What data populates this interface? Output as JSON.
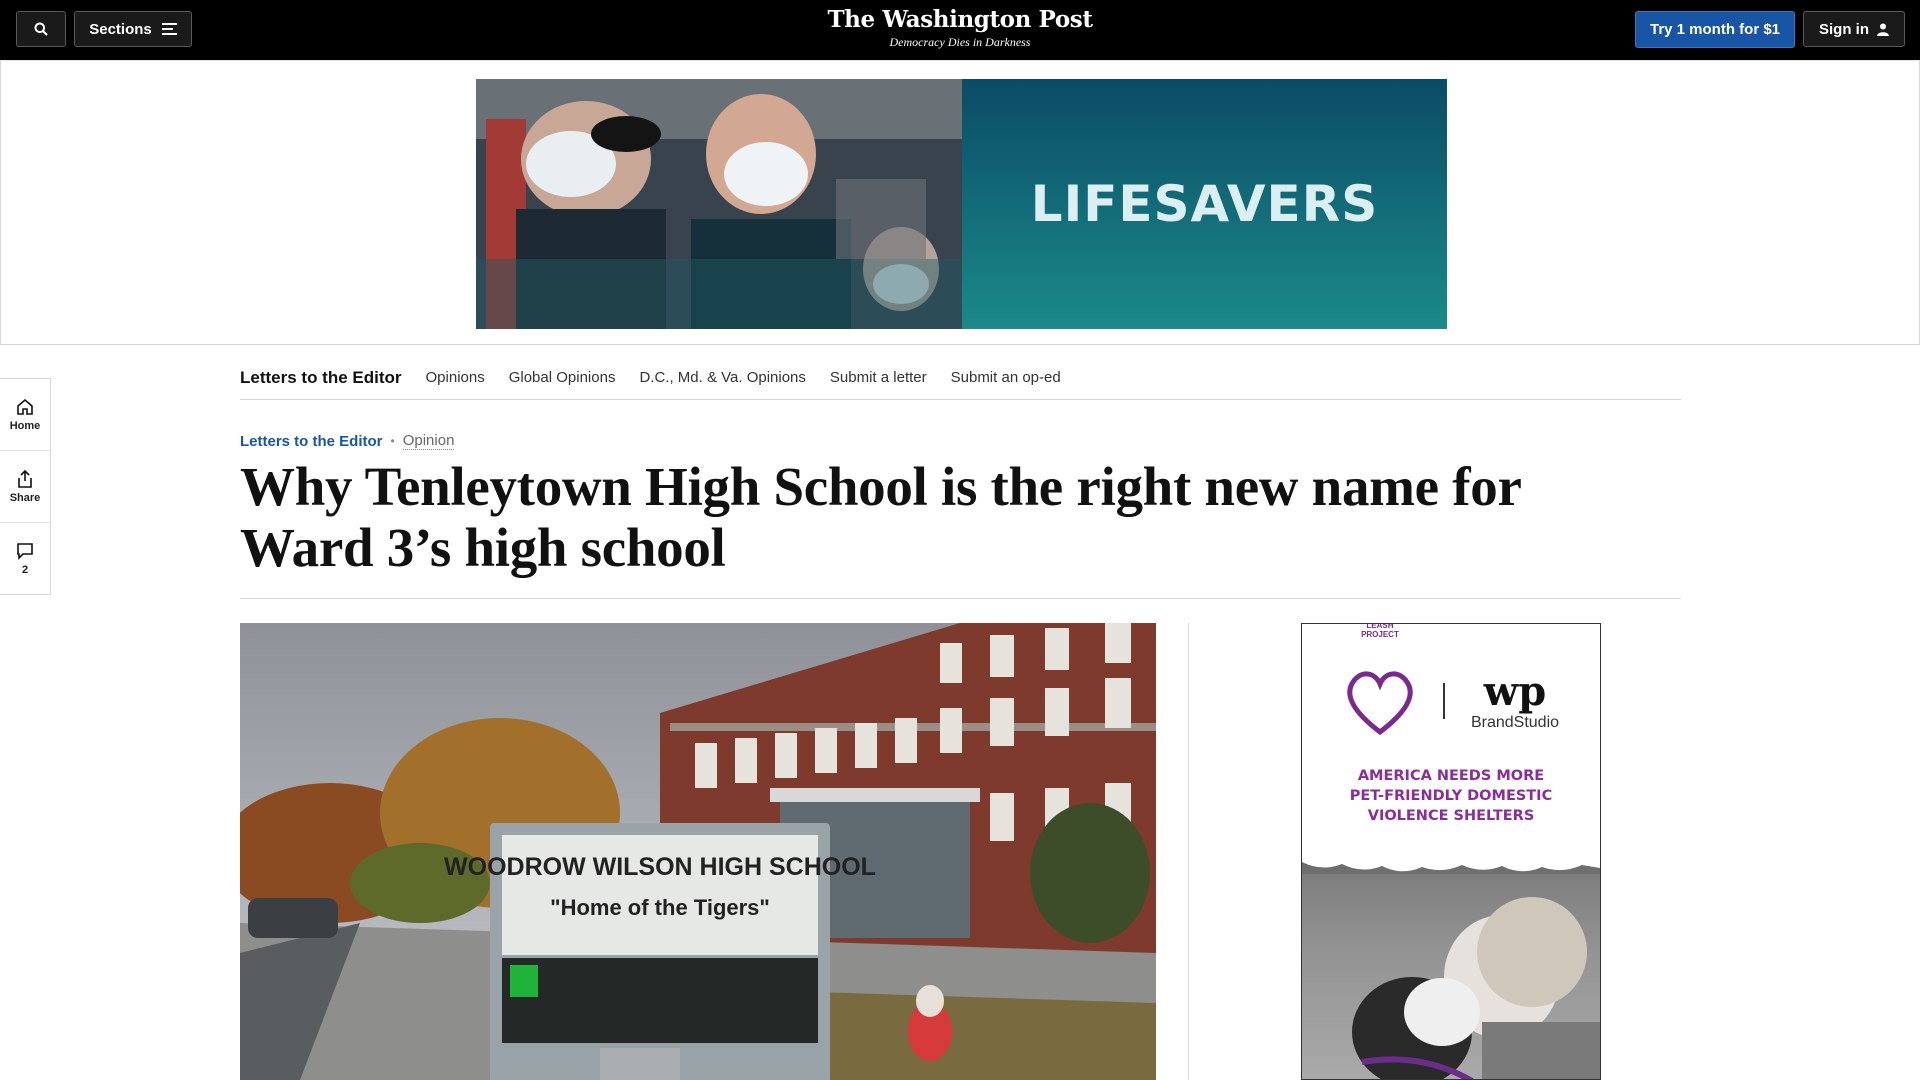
{
  "header": {
    "sections_label": "Sections",
    "logo": "The Washington Post",
    "tagline": "Democracy Dies in Darkness",
    "trial_label": "Try 1 month for $1",
    "signin_label": "Sign in"
  },
  "top_ad": {
    "headline": "LIFESAVERS"
  },
  "rail": {
    "home": "Home",
    "share": "Share",
    "comments_count": "2"
  },
  "subnav": {
    "title": "Letters to the Editor",
    "links": [
      "Opinions",
      "Global Opinions",
      "D.C., Md. & Va. Opinions",
      "Submit a letter",
      "Submit an op-ed"
    ]
  },
  "article": {
    "kicker_section": "Letters to the Editor",
    "kicker_label": "Opinion",
    "headline": "Why Tenleytown High School is the right new name for Ward 3’s high school"
  },
  "photo": {
    "sign_line1": "WOODROW WILSON HIGH SCHOOL",
    "sign_line2": "\"Home of the Tigers\""
  },
  "side_ad": {
    "partner_logo_text": "PURPLE LEASH PROJECT",
    "wp_logo": "wp",
    "brand_studio": "BrandStudio",
    "headline_line1": "AMERICA NEEDS MORE",
    "headline_line2": "PET-FRIENDLY DOMESTIC",
    "headline_line3": "VIOLENCE SHELTERS"
  }
}
